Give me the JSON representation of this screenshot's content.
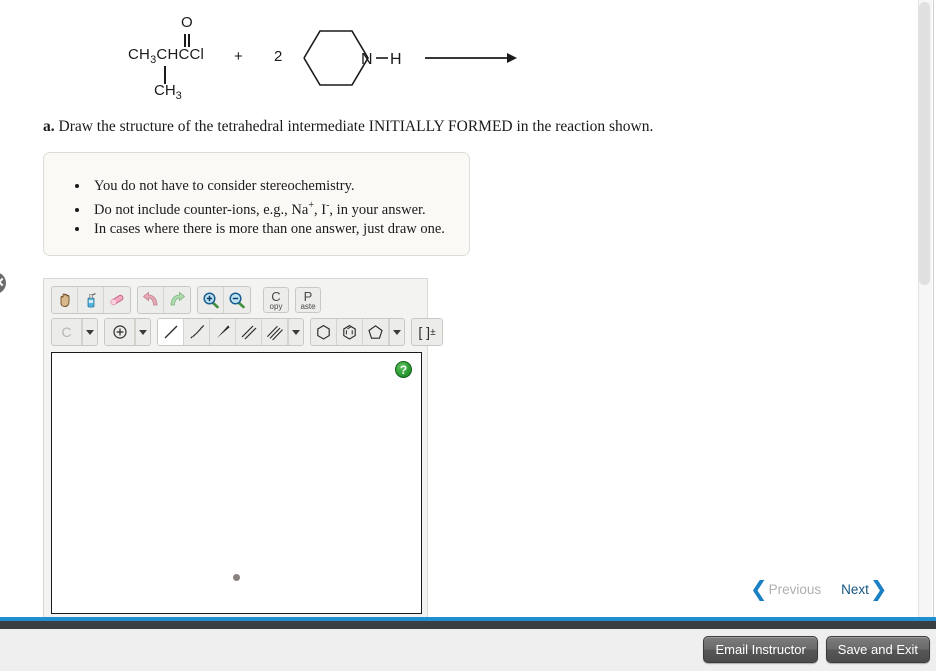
{
  "reaction": {
    "acyl_chloride": {
      "main": "CH3CHCCl",
      "main_parts": [
        "CH",
        "3",
        "CHCCl"
      ],
      "oxygen_label": "O",
      "branch": "CH3",
      "branch_parts": [
        "CH",
        "3"
      ]
    },
    "plus": "+",
    "coefficient": "2",
    "amine_nitrogen": "N",
    "amine_hydrogen": "H",
    "arrow": "reaction-arrow"
  },
  "question": {
    "label": "a.",
    "text": "Draw the structure of the tetrahedral intermediate INITIALLY FORMED in the reaction shown."
  },
  "hints": {
    "items": [
      {
        "text": "You do not have to consider stereochemistry."
      },
      {
        "pre": "Do not include counter-ions, e.g., Na",
        "sup1": "+",
        "mid": ", I",
        "sup2": "-",
        "post": ", in your answer."
      },
      {
        "text": "In cases where there is more than one answer, just draw one."
      }
    ]
  },
  "editor": {
    "toolbar_row1": [
      {
        "name": "pan-tool",
        "title": "Pan"
      },
      {
        "name": "clean-tool",
        "title": "Clean"
      },
      {
        "name": "eraser-tool",
        "title": "Eraser"
      },
      {
        "name": "undo-tool",
        "title": "Undo"
      },
      {
        "name": "redo-tool",
        "title": "Redo"
      },
      {
        "name": "zoom-in-tool",
        "title": "Zoom In"
      },
      {
        "name": "zoom-out-tool",
        "title": "Zoom Out"
      }
    ],
    "copy_label_big": "C",
    "copy_label_small": "opy",
    "paste_label_big": "P",
    "paste_label_small": "aste",
    "element_label": "C",
    "charge_label": "charge-tool",
    "bond_tools": [
      {
        "name": "single-bond-tool",
        "selected": true
      },
      {
        "name": "hash-bond-tool",
        "selected": false
      },
      {
        "name": "wedge-bond-tool",
        "selected": false
      },
      {
        "name": "double-bond-tool",
        "selected": false
      },
      {
        "name": "triple-bond-tool",
        "selected": false
      }
    ],
    "ring_tools": [
      {
        "name": "cyclohexane-ring-tool"
      },
      {
        "name": "benzene-ring-tool"
      },
      {
        "name": "cyclopentane-ring-tool"
      }
    ],
    "bracket_label": "[ ]",
    "bracket_sup": "±",
    "help_label": "?"
  },
  "navigation": {
    "previous_label": "Previous",
    "next_label": "Next",
    "previous_chevron": "❮",
    "next_chevron": "❯"
  },
  "bottom_bar": {
    "email_instructor_label": "Email Instructor",
    "save_and_exit_label": "Save and Exit"
  },
  "colors": {
    "accent_blue": "#1f8fce",
    "next_blue": "#16557f",
    "disabled_gray": "#b0b0b0",
    "help_green": "#2e9e35",
    "bar_dark": "#3a3f42"
  }
}
